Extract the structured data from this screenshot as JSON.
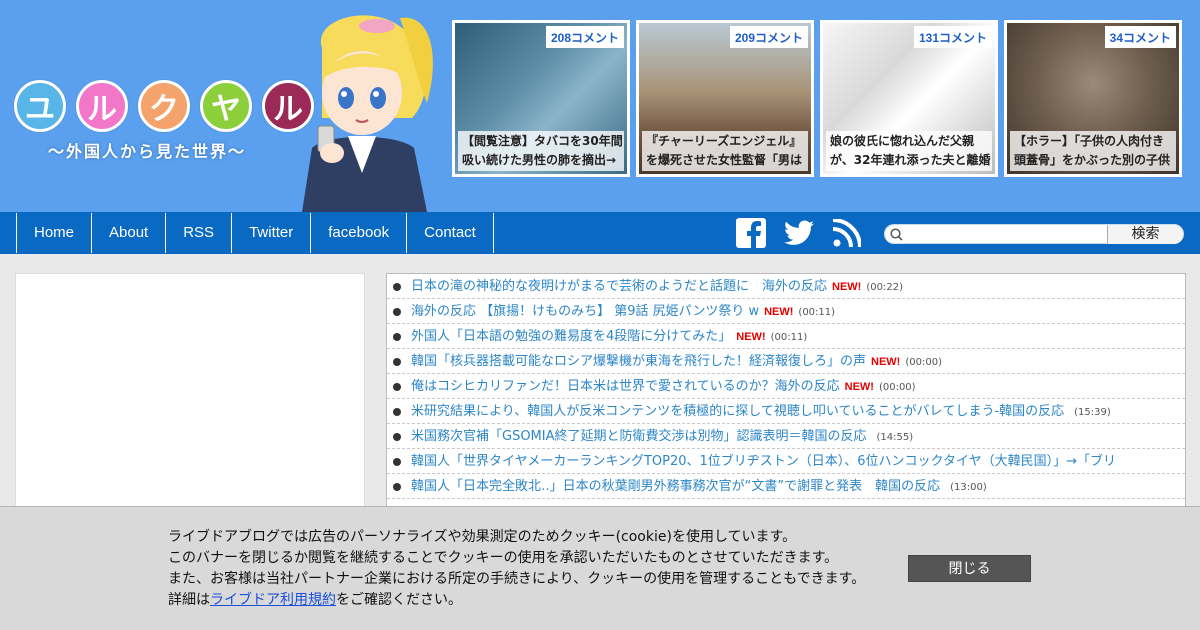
{
  "logo": {
    "chars": [
      {
        "char": "ユ",
        "color": "#57b5e8"
      },
      {
        "char": "ル",
        "color": "#f277c9"
      },
      {
        "char": "ク",
        "color": "#f4a36c"
      },
      {
        "char": "ヤ",
        "color": "#8ccf3a"
      },
      {
        "char": "ル",
        "color": "#9b2a58"
      }
    ],
    "subtitle": "〜外国人から見た世界〜"
  },
  "thumbs": [
    {
      "comments": "208コメント",
      "caption_line1": "【閲覧注意】タバコを30年間",
      "caption_line2": "吸い続けた男性の肺を摘出→",
      "bg": "#3d6f8e"
    },
    {
      "comments": "209コメント",
      "caption_line1": "『チャーリーズエンジェル』",
      "caption_line2": "を爆死させた女性監督「男は",
      "bg": "#a08060"
    },
    {
      "comments": "131コメント",
      "caption_line1": "娘の彼氏に惚れ込んだ父親",
      "caption_line2": "が、32年連れ添った夫と離婚",
      "bg": "#e8e8e8"
    },
    {
      "comments": "34コメント",
      "caption_line1": "【ホラー】「子供の人肉付き",
      "caption_line2": "頭蓋骨」をかぶった別の子供",
      "bg": "#6b5a4a"
    }
  ],
  "nav": {
    "items": [
      "Home",
      "About",
      "RSS",
      "Twitter",
      "facebook",
      "Contact"
    ],
    "search_button": "検索",
    "search_placeholder": ""
  },
  "news": [
    {
      "title": "日本の滝の神秘的な夜明けがまるで芸術のようだと話題に　海外の反応",
      "new": "NEW!",
      "time": "(00:22)"
    },
    {
      "title": "海外の反応 【旗揚！けものみち】 第9話 尻姫パンツ祭り w",
      "new": "NEW!",
      "time": "(00:11)"
    },
    {
      "title": "外国人「日本語の勉強の難易度を4段階に分けてみた」",
      "new": "NEW!",
      "time": "(00:11)"
    },
    {
      "title": "韓国「核兵器搭載可能なロシア爆撃機が東海を飛行した！経済報復しろ」の声",
      "new": "NEW!",
      "time": "(00:00)"
    },
    {
      "title": "俺はコシヒカリファンだ！日本米は世界で愛されているのか？海外の反応",
      "new": "NEW!",
      "time": "(00:00)"
    },
    {
      "title": "米研究結果により、韓国人が反米コンテンツを積極的に探して視聴し叩いていることがバレてしまう-韓国の反応",
      "new": "",
      "time": "(15:39)"
    },
    {
      "title": "米国務次官補「GSOMIA終了延期と防衛費交渉は別物」認識表明＝韓国の反応",
      "new": "",
      "time": "(14:55)"
    },
    {
      "title": "韓国人「世界タイヤメーカーランキングTOP20、1位ブリヂストン（日本）、6位ハンコックタイヤ（大韓民国）」→「ブリ",
      "new": "",
      "time": ""
    },
    {
      "title": "韓国人「日本完全敗北‥」日本の秋葉剛男外務事務次官が“文書”で謝罪と発表　韓国の反応",
      "new": "",
      "time": "(13:00)"
    }
  ],
  "cookie": {
    "line1": "ライブドアブログでは広告のパーソナライズや効果測定のためクッキー(cookie)を使用しています。",
    "line2": "このバナーを閉じるか閲覧を継続することでクッキーの使用を承認いただいたものとさせていただきます。",
    "line3": "また、お客様は当社パートナー企業における所定の手続きにより、クッキーの使用を管理することもできます。",
    "line4_prefix": "詳細は",
    "line4_link": "ライブドア利用規約",
    "line4_suffix": "をご確認ください。",
    "close_button": "閉じる"
  }
}
